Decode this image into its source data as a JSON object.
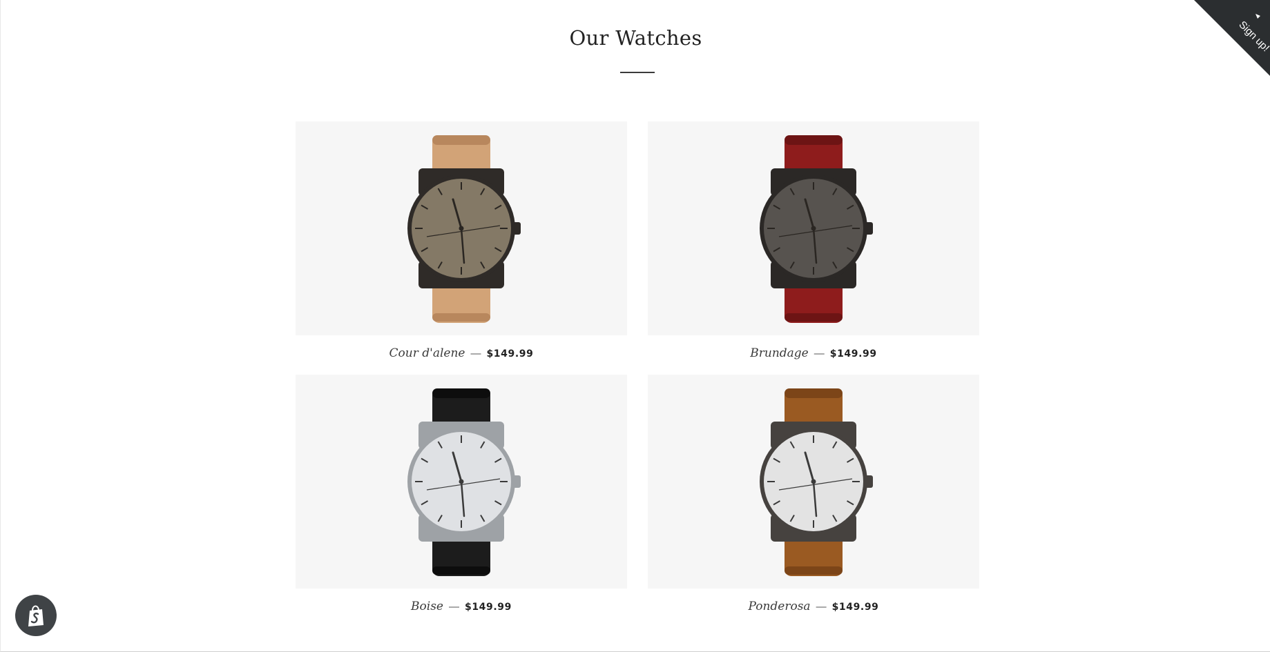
{
  "collection": {
    "title": "Our Watches"
  },
  "products": [
    {
      "name": "Cour d'alene",
      "separator": "—",
      "price": "$149.99",
      "strap_color": "#d2a377",
      "strap_shade": "#b8875d",
      "dial_color": "#847966",
      "case_color": "#2f2b28"
    },
    {
      "name": "Brundage",
      "separator": "—",
      "price": "$149.99",
      "strap_color": "#8e1c1c",
      "strap_shade": "#6d1414",
      "dial_color": "#57534f",
      "case_color": "#2b2826"
    },
    {
      "name": "Boise",
      "separator": "—",
      "price": "$149.99",
      "strap_color": "#1c1c1c",
      "strap_shade": "#0d0d0d",
      "dial_color": "#dfe1e4",
      "case_color": "#9ea2a6"
    },
    {
      "name": "Ponderosa",
      "separator": "—",
      "price": "$149.99",
      "strap_color": "#9a5a22",
      "strap_shade": "#7c4518",
      "dial_color": "#e3e3e3",
      "case_color": "#46423f"
    }
  ],
  "signup": {
    "label": "Sign up!",
    "background": "#2b2e30",
    "icon": "caret-icon"
  },
  "shopify_badge": {
    "icon": "shopify-bag-icon",
    "background": "#3f4346"
  }
}
